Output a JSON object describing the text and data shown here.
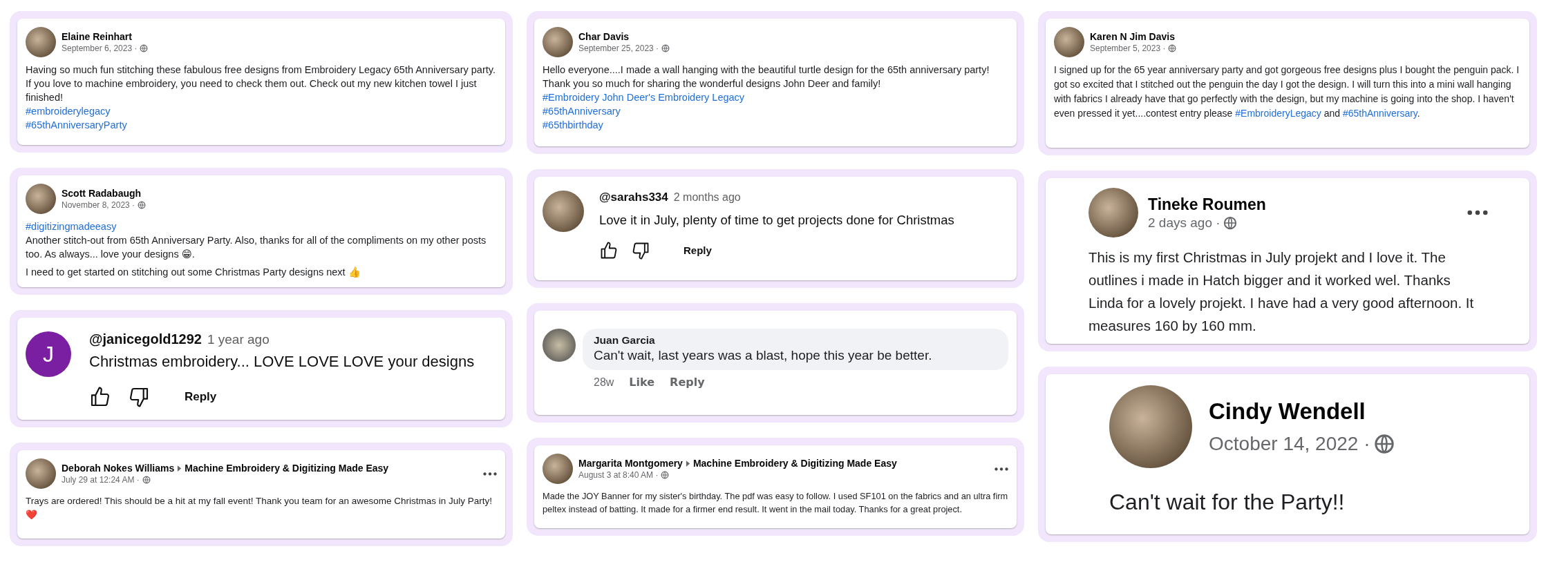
{
  "columns": [
    {
      "cards": [
        {
          "kind": "post",
          "author": "Elaine Reinhart",
          "date": "September 6, 2023 ·",
          "more": false,
          "paragraphs": [
            [
              {
                "text": "Having so much fun stitching these fabulous free designs from Embroidery Legacy 65th Anniversary party. If you love to machine embroidery, you need to check them out. Check out my new kitchen towel I just finished!"
              }
            ],
            [
              {
                "text": "#embroiderylegacy",
                "tag": true
              }
            ],
            [
              {
                "text": "#65thAnniversaryParty",
                "tag": true
              }
            ]
          ]
        },
        {
          "kind": "post",
          "author": "Scott Radabaugh",
          "date": "November 8, 2023 ·",
          "more": false,
          "paragraphs": [
            [
              {
                "text": "#digitizingmadeeasy",
                "tag": true
              }
            ],
            [
              {
                "text": "Another stitch-out from 65th Anniversary Party.  Also, thanks for all of the compliments on my other posts too.  As always... love your designs 😁."
              }
            ],
            [
              {
                "text": "I need to get started on stitching out some Christmas Party designs next 👍"
              }
            ]
          ]
        },
        {
          "kind": "youtube",
          "handle": "@janicegold1292",
          "time": "1 year ago",
          "initial": "J",
          "text": "Christmas embroidery... LOVE LOVE LOVE your designs",
          "reply": "Reply"
        },
        {
          "kind": "post",
          "author": "Deborah Nokes Williams",
          "group": "Machine Embroidery & Digitizing Made Easy",
          "date": "July 29 at 12:24 AM ·",
          "more": true,
          "paragraphs": [
            [
              {
                "text": "Trays are ordered! This should be a hit at my fall event!  Thank you team for an awesome Christmas in July Party! ❤️"
              }
            ]
          ]
        }
      ]
    },
    {
      "cards": [
        {
          "kind": "post",
          "author": "Char Davis",
          "date": "September 25, 2023 ·",
          "more": false,
          "paragraphs": [
            [
              {
                "text": "Hello everyone....I made a wall hanging with the beautiful turtle design for the 65th anniversary party!  Thank you so much for sharing the wonderful designs John Deer and family!"
              }
            ],
            [
              {
                "text": "#Embroidery John Deer's Embroidery Legacy",
                "tag": true
              }
            ],
            [
              {
                "text": "#65thAnniversary",
                "tag": true
              }
            ],
            [
              {
                "text": "#65thbirthday",
                "tag": true
              }
            ]
          ]
        },
        {
          "kind": "youtube",
          "handle": "@sarahs334",
          "time": "2 months ago",
          "text": "Love it in July, plenty of time to get projects done for Christmas",
          "reply": "Reply"
        },
        {
          "kind": "comment",
          "author": "Juan Garcia",
          "text": "Can't wait, last years was a blast, hope this year be better.",
          "time": "28w",
          "actions": [
            "Like",
            "Reply"
          ]
        },
        {
          "kind": "post",
          "author": "Margarita Montgomery",
          "group": "Machine Embroidery & Digitizing Made Easy",
          "date": "August 3 at 8:40 AM ·",
          "more": true,
          "paragraphs": [
            [
              {
                "text": "Made the JOY Banner for my sister's birthday. The pdf was easy to follow. I used SF101 on the fabrics and an ultra firm peltex instead of batting. It made for a firmer end result. It went in the mail today. Thanks for a great project."
              }
            ]
          ]
        }
      ]
    },
    {
      "cards": [
        {
          "kind": "post",
          "author": "Karen N Jim Davis",
          "date": "September 5, 2023 ·",
          "more": false,
          "paragraphs": [
            [
              {
                "text": "I signed up for the 65 year anniversary party and got gorgeous free designs plus I bought the penguin pack. I got so excited that I stitched out the penguin the day I got the design. I will turn this into a mini wall hanging with fabrics I already have that go perfectly with the design, but my machine is going into the shop. I haven't even pressed it yet....contest entry please "
              },
              {
                "text": "#EmbroideryLegacy",
                "tag": true
              },
              {
                "text": " and "
              },
              {
                "text": "#65thAnniversary",
                "tag": true
              },
              {
                "text": "."
              }
            ]
          ]
        },
        {
          "kind": "large",
          "author": "Tineke Roumen",
          "date": "2 days ago ·",
          "more": true,
          "paragraphs": [
            [
              {
                "text": "This is my first Christmas in July projekt and I love it. The outlines i made in Hatch bigger and it worked wel. Thanks Linda for a lovely projekt. I have had a very good afternoon. It measures 160 by 160 mm."
              }
            ]
          ]
        },
        {
          "kind": "huge",
          "author": "Cindy Wendell",
          "date": "October 14, 2022 ·",
          "more": false,
          "paragraphs": [
            [
              {
                "text": "Can't wait for the Party!!"
              }
            ]
          ]
        }
      ]
    }
  ]
}
